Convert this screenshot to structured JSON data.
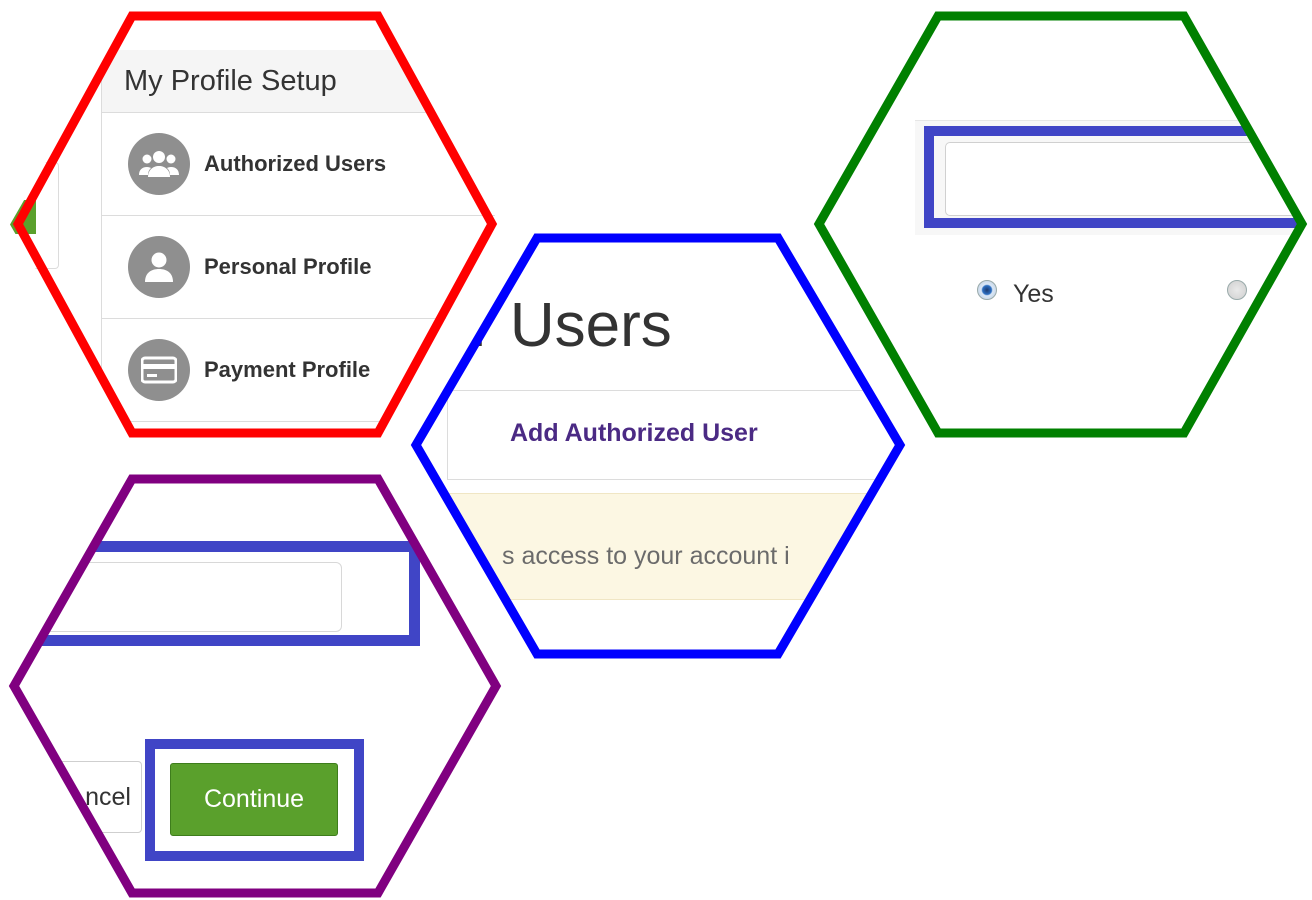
{
  "menu": {
    "title": "My Profile Setup",
    "items": [
      {
        "label": "Authorized Users",
        "icon": "users-icon"
      },
      {
        "label": "Personal Profile",
        "icon": "user-icon"
      },
      {
        "label": "Payment Profile",
        "icon": "credit-card-icon"
      }
    ]
  },
  "page": {
    "title_fragment": "r Users",
    "tab_label": "Add Authorized User",
    "notice_fragment": "s access to your account i"
  },
  "form": {
    "radio_yes_label": "Yes"
  },
  "actions": {
    "cancel_fragment": "ncel",
    "continue_label": "Continue"
  },
  "colors": {
    "red_outline": "#ff0000",
    "blue_outline": "#0000ff",
    "green_outline": "#008000",
    "purple_outline": "#800080",
    "highlight": "#4045c6",
    "button_green": "#5aa02c",
    "link_purple": "#4b2a84"
  }
}
